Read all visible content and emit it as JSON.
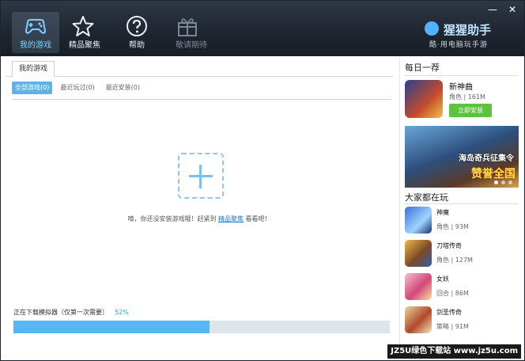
{
  "nav": {
    "items": [
      {
        "label": "我的游戏",
        "icon": "gamepad-icon"
      },
      {
        "label": "精品聚焦",
        "icon": "star-icon"
      },
      {
        "label": "帮助",
        "icon": "question-icon"
      },
      {
        "label": "敬请期待",
        "icon": "gift-icon"
      }
    ]
  },
  "window": {
    "minimize": "—",
    "close": "✕"
  },
  "logo": {
    "name": "猩猩助手",
    "slogan": "酷·用电脑玩手游"
  },
  "main": {
    "tab": "我的游戏",
    "subtabs": [
      "全部游戏(0)",
      "最近玩过(0)",
      "最近安装(0)"
    ],
    "empty_text": "唷，你还没安装游戏哦！赶紧到",
    "empty_link": "精品聚焦",
    "empty_suffix": "看看吧！",
    "download_text": "正在下载模拟器（仅第一次需要）",
    "download_percent": "52%",
    "download_value": 52
  },
  "sidebar": {
    "daily_title": "每日一荐",
    "featured": {
      "name": "新神曲",
      "meta": "角色 | 161M",
      "button": "立即安装"
    },
    "banner": {
      "title": "海岛奇兵征集令",
      "cta": "赞誉全国"
    },
    "popular_title": "大家都在玩",
    "popular": [
      {
        "name": "神魔",
        "meta": "角色 | 93M"
      },
      {
        "name": "刀塔传奇",
        "meta": "角色 | 127M"
      },
      {
        "name": "女妖",
        "meta": "回合 | 86M"
      },
      {
        "name": "剑圣传奇",
        "meta": "策略 | 91M"
      }
    ]
  },
  "watermark": "JZ5U绿色下载站 www.jz5u.com",
  "colors": {
    "accent": "#56b7f3",
    "install": "#5cc33f",
    "header": "#1e252f",
    "link": "#1b78d0"
  }
}
